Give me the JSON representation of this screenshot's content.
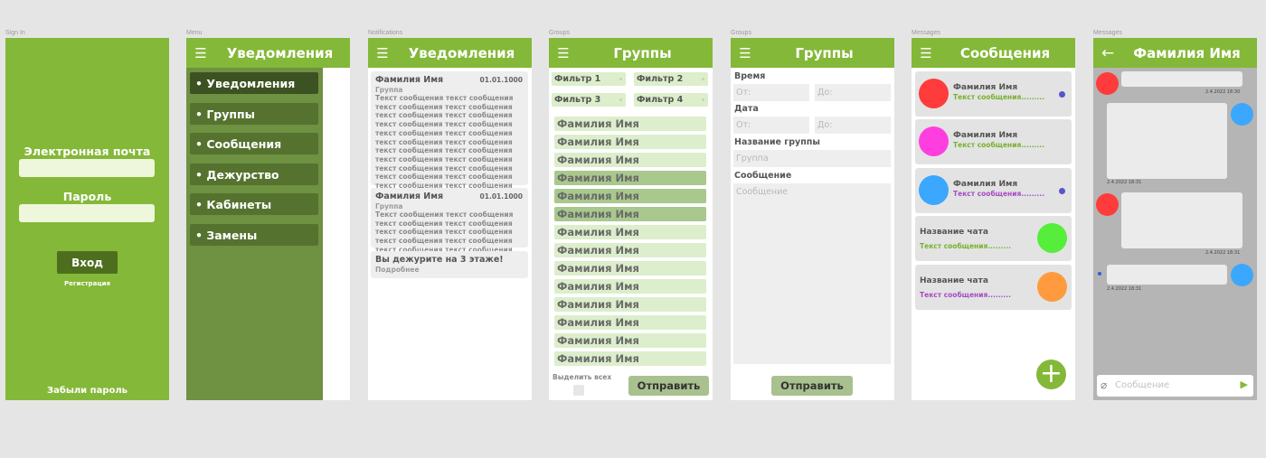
{
  "colors": {
    "brand": "#84b838",
    "menu_bg": "#6e9142",
    "menu_item": "#55732f",
    "menu_active": "#3d5222",
    "filter": "#dceecb",
    "selected": "#a8c88d"
  },
  "signin": {
    "frame_label": "Sign In",
    "email_label": "Электронная почта",
    "password_label": "Пароль",
    "login_button": "Вход",
    "register_link": "Регистрация",
    "forgot_link": "Забыли пароль"
  },
  "menu": {
    "frame_label": "Menu",
    "title": "Уведомления",
    "items": [
      {
        "label": "• Уведомления",
        "active": true
      },
      {
        "label": "• Группы"
      },
      {
        "label": "• Сообщения"
      },
      {
        "label": "• Дежурство"
      },
      {
        "label": "• Кабинеты"
      },
      {
        "label": "• Замены"
      }
    ]
  },
  "notifications": {
    "frame_label": "Notifications",
    "title": "Уведомления",
    "cards": [
      {
        "name": "Фамилия Имя",
        "date": "01.01.1000",
        "group": "Группа",
        "lines": [
          "Текст сообщения текст сообщения",
          "текст сообщения текст сообщения",
          "текст сообщения текст сообщения",
          "текст сообщения текст сообщения",
          "текст сообщения текст сообщения",
          "текст сообщения текст сообщения",
          "текст сообщения текст сообщения",
          "текст сообщения текст сообщения",
          "текст сообщения текст сообщения",
          "текст сообщения текст сообщения",
          "текст сообщения текст сообщения"
        ]
      },
      {
        "name": "Фамилия Имя",
        "date": "01.01.1000",
        "group": "Группа",
        "lines": [
          "Текст сообщения текст сообщения",
          "текст сообщения текст сообщения",
          "текст сообщения текст сообщения",
          "текст сообщения текст сообщения",
          "текст сообщения текст сообщения"
        ]
      },
      {
        "name": "Вы дежурите на 3 этаже!",
        "more": "Подробнее"
      }
    ]
  },
  "groups": {
    "frame_label": "Groups",
    "title": "Группы",
    "filters": [
      "Фильтр 1",
      "Фильтр 2",
      "Фильтр 3",
      "Фильтр 4"
    ],
    "people": [
      {
        "name": "Фамилия Имя"
      },
      {
        "name": "Фамилия Имя"
      },
      {
        "name": "Фамилия Имя"
      },
      {
        "name": "Фамилия Имя",
        "selected": true
      },
      {
        "name": "Фамилия Имя",
        "selected": true
      },
      {
        "name": "Фамилия Имя",
        "selected": true
      },
      {
        "name": "Фамилия Имя"
      },
      {
        "name": "Фамилия Имя"
      },
      {
        "name": "Фамилия Имя"
      },
      {
        "name": "Фамилия Имя"
      },
      {
        "name": "Фамилия Имя"
      },
      {
        "name": "Фамилия Имя"
      },
      {
        "name": "Фамилия Имя"
      },
      {
        "name": "Фамилия Имя"
      }
    ],
    "select_all": "Выделить всех",
    "send_button": "Отправить"
  },
  "groups_form": {
    "frame_label": "Groups",
    "title": "Группы",
    "time_label": "Время",
    "date_label": "Дата",
    "from_placeholder": "От:",
    "to_placeholder": "До:",
    "group_name_label": "Название группы",
    "group_placeholder": "Группа",
    "message_label": "Сообщение",
    "message_placeholder": "Сообщение",
    "send_button": "Отправить"
  },
  "messages": {
    "frame_label": "Messages",
    "title": "Сообщения",
    "chats": [
      {
        "name": "Фамилия Имя",
        "text": "Текст сообщения.........",
        "avatar_color": "#ff3b3b",
        "text_color": "#77b12e",
        "unread": true,
        "avatar_side": "left"
      },
      {
        "name": "Фамилия Имя",
        "text": "Текст сообщения.........",
        "avatar_color": "#ff3ee0",
        "text_color": "#77b12e",
        "unread": false,
        "avatar_side": "left"
      },
      {
        "name": "Фамилия Имя",
        "text": "Текст сообщения.........",
        "avatar_color": "#3ba7ff",
        "text_color": "#a64cc4",
        "unread": true,
        "avatar_side": "left"
      },
      {
        "name": "Название чата",
        "text": "Текст сообщения.........",
        "avatar_color": "#55ee3b",
        "text_color": "#77b12e",
        "unread": false,
        "avatar_side": "right"
      },
      {
        "name": "Название чата",
        "text": "Текст сообщения.........",
        "avatar_color": "#ff9a3e",
        "text_color": "#a64cc4",
        "unread": false,
        "avatar_side": "right"
      }
    ],
    "add_button": "+"
  },
  "conversation": {
    "frame_label": "Messages",
    "title": "Фамилия Имя",
    "timestamps": [
      "2.4.2022 18:30",
      "2.4.2022 18:31",
      "2.4.2022 18:31",
      "2.4.2022 18:31"
    ],
    "placeholder": "Сообщение"
  }
}
